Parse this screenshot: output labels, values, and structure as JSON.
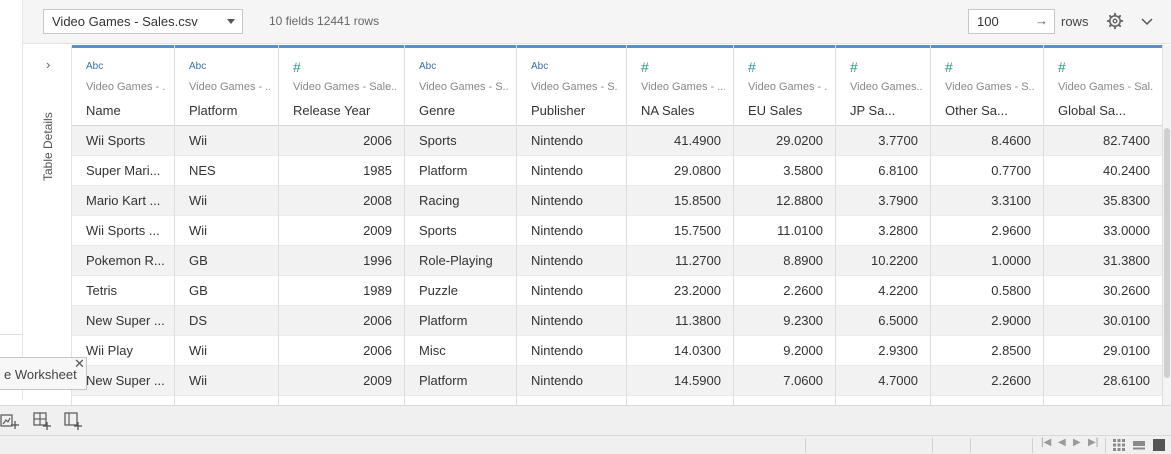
{
  "toolbar": {
    "source_file": "Video Games - Sales.csv",
    "meta": "10 fields 12441 rows",
    "rows_value": "100",
    "rows_label": "rows"
  },
  "details_panel": {
    "label": "Table Details"
  },
  "tooltip": {
    "text": "e Worksheet"
  },
  "columns": [
    {
      "type": "Abc",
      "source": "Video Games - ...",
      "name": "Name"
    },
    {
      "type": "Abc",
      "source": "Video Games - ...",
      "name": "Platform"
    },
    {
      "type": "#",
      "source": "Video Games - Sale...",
      "name": "Release Year"
    },
    {
      "type": "Abc",
      "source": "Video Games - S...",
      "name": "Genre"
    },
    {
      "type": "Abc",
      "source": "Video Games - S...",
      "name": "Publisher"
    },
    {
      "type": "#",
      "source": "Video Games - ...",
      "name": "NA Sales"
    },
    {
      "type": "#",
      "source": "Video Games - ...",
      "name": "EU Sales"
    },
    {
      "type": "#",
      "source": "Video Games...",
      "name": "JP Sa..."
    },
    {
      "type": "#",
      "source": "Video Games - S...",
      "name": "Other Sa..."
    },
    {
      "type": "#",
      "source": "Video Games - Sal...",
      "name": "Global Sa..."
    }
  ],
  "rows": [
    [
      "Wii Sports",
      "Wii",
      "2006",
      "Sports",
      "Nintendo",
      "41.4900",
      "29.0200",
      "3.7700",
      "8.4600",
      "82.7400"
    ],
    [
      "Super Mari...",
      "NES",
      "1985",
      "Platform",
      "Nintendo",
      "29.0800",
      "3.5800",
      "6.8100",
      "0.7700",
      "40.2400"
    ],
    [
      "Mario Kart ...",
      "Wii",
      "2008",
      "Racing",
      "Nintendo",
      "15.8500",
      "12.8800",
      "3.7900",
      "3.3100",
      "35.8300"
    ],
    [
      "Wii Sports ...",
      "Wii",
      "2009",
      "Sports",
      "Nintendo",
      "15.7500",
      "11.0100",
      "3.2800",
      "2.9600",
      "33.0000"
    ],
    [
      "Pokemon R...",
      "GB",
      "1996",
      "Role-Playing",
      "Nintendo",
      "11.2700",
      "8.8900",
      "10.2200",
      "1.0000",
      "31.3800"
    ],
    [
      "Tetris",
      "GB",
      "1989",
      "Puzzle",
      "Nintendo",
      "23.2000",
      "2.2600",
      "4.2200",
      "0.5800",
      "30.2600"
    ],
    [
      "New Super ...",
      "DS",
      "2006",
      "Platform",
      "Nintendo",
      "11.3800",
      "9.2300",
      "6.5000",
      "2.9000",
      "30.0100"
    ],
    [
      "Wii Play",
      "Wii",
      "2006",
      "Misc",
      "Nintendo",
      "14.0300",
      "9.2000",
      "2.9300",
      "2.8500",
      "29.0100"
    ],
    [
      "New Super ...",
      "Wii",
      "2009",
      "Platform",
      "Nintendo",
      "14.5900",
      "7.0600",
      "4.7000",
      "2.2600",
      "28.6100"
    ]
  ],
  "icons": {
    "dropdown": "caret-down-icon",
    "go": "arrow-right-icon",
    "settings": "gear-icon",
    "collapse": "chevron-down-icon",
    "expand_details": "chevron-right-icon",
    "close_tooltip": "close-icon",
    "new_worksheet": "new-worksheet-icon",
    "new_dashboard": "new-dashboard-icon",
    "new_story": "new-story-icon"
  },
  "colors": {
    "accent_blue": "#5b8fc7",
    "string_type": "#3a6fb0",
    "number_type": "#2a9a86"
  }
}
